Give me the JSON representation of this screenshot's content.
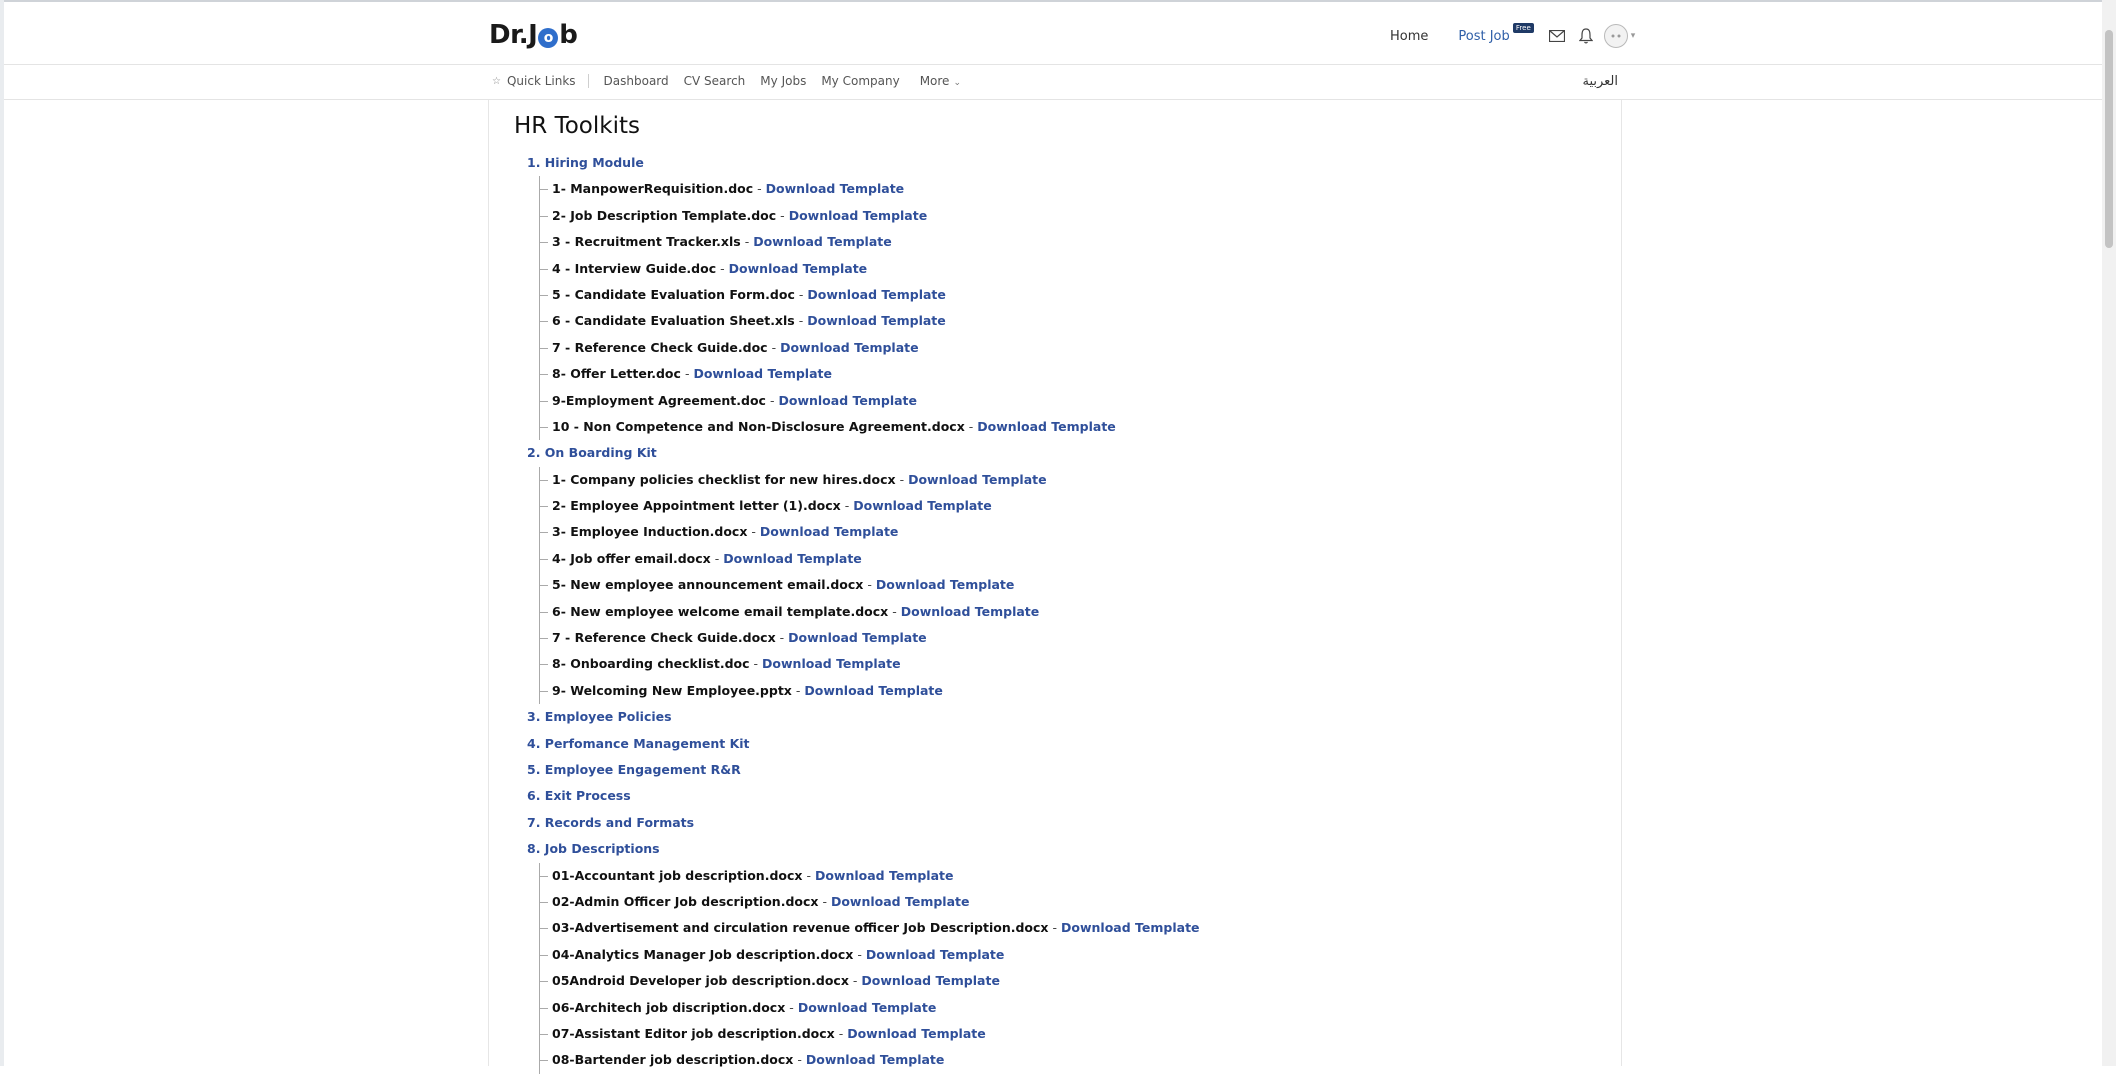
{
  "header": {
    "logo_text_before": "Dr.J",
    "logo_text_o": "o",
    "logo_text_after": "b",
    "home_label": "Home",
    "post_job_label": "Post Job",
    "free_badge": "Free",
    "accent_color": "#2f4f9a"
  },
  "subnav": {
    "quick_links": "Quick Links",
    "items": [
      "Dashboard",
      "CV Search",
      "My Jobs",
      "My Company"
    ],
    "more": "More",
    "arabic": "العربية"
  },
  "page": {
    "title": "HR Toolkits",
    "sections": [
      {
        "title": "1. Hiring Module",
        "items": [
          {
            "file": "1- ManpowerRequisition.doc",
            "link": "Download Template"
          },
          {
            "file": "2- Job Description Template.doc",
            "link": "Download Template"
          },
          {
            "file": "3 - Recruitment Tracker.xls",
            "link": "Download Template"
          },
          {
            "file": "4 - Interview Guide.doc",
            "link": "Download Template"
          },
          {
            "file": "5 - Candidate Evaluation Form.doc",
            "link": "Download Template"
          },
          {
            "file": "6 - Candidate Evaluation Sheet.xls",
            "link": "Download Template"
          },
          {
            "file": "7 - Reference Check Guide.doc",
            "link": "Download Template"
          },
          {
            "file": "8- Offer Letter.doc",
            "link": "Download Template"
          },
          {
            "file": "9-Employment Agreement.doc",
            "link": "Download Template"
          },
          {
            "file": "10 - Non Competence and Non-Disclosure Agreement.docx",
            "link": "Download Template"
          }
        ]
      },
      {
        "title": "2. On Boarding Kit",
        "items": [
          {
            "file": "1- Company policies checklist for new hires.docx",
            "link": "Download Template"
          },
          {
            "file": "2- Employee Appointment letter (1).docx",
            "link": "Download Template"
          },
          {
            "file": "3- Employee Induction.docx",
            "link": "Download Template"
          },
          {
            "file": "4- Job offer email.docx",
            "link": "Download Template"
          },
          {
            "file": "5- New employee announcement email.docx",
            "link": "Download Template"
          },
          {
            "file": "6- New employee welcome email template.docx",
            "link": "Download Template"
          },
          {
            "file": "7 - Reference Check Guide.docx",
            "link": "Download Template"
          },
          {
            "file": "8- Onboarding checklist.doc",
            "link": "Download Template"
          },
          {
            "file": "9- Welcoming New Employee.pptx",
            "link": "Download Template"
          }
        ]
      },
      {
        "title": "3. Employee Policies",
        "items": []
      },
      {
        "title": "4. Perfomance Management Kit",
        "items": []
      },
      {
        "title": "5. Employee Engagement R&R",
        "items": []
      },
      {
        "title": "6. Exit Process",
        "items": []
      },
      {
        "title": "7. Records and Formats",
        "items": []
      },
      {
        "title": "8. Job Descriptions",
        "items": [
          {
            "file": "01-Accountant job description.docx",
            "link": "Download Template"
          },
          {
            "file": "02-Admin Officer Job description.docx",
            "link": "Download Template"
          },
          {
            "file": "03-Advertisement and circulation revenue officer Job Description.docx",
            "link": "Download Template"
          },
          {
            "file": "04-Analytics Manager Job description.docx",
            "link": "Download Template"
          },
          {
            "file": "05Android Developer job description.docx",
            "link": "Download Template"
          },
          {
            "file": "06-Architech job discription.docx",
            "link": "Download Template"
          },
          {
            "file": "07-Assistant Editor job description.docx",
            "link": "Download Template"
          },
          {
            "file": "08-Bartender job description.docx",
            "link": "Download Template"
          }
        ]
      }
    ]
  }
}
